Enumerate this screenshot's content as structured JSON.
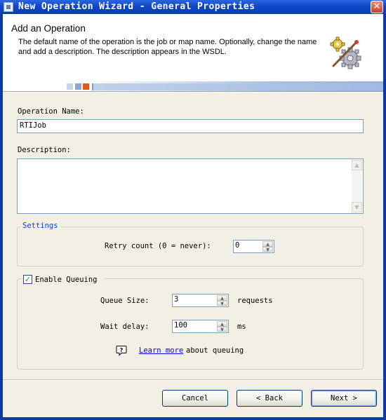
{
  "window": {
    "title": "New Operation Wizard - General Properties",
    "close_glyph": "✕"
  },
  "header": {
    "heading": "Add an Operation",
    "description": "The default name of the operation is the job or map name. Optionally, change the name and add a description. The description appears in the WSDL.",
    "icon": "wizard-gears-icon"
  },
  "form": {
    "operation_name_label": "Operation Name:",
    "operation_name_value": "RTIJob",
    "description_label": "Description:",
    "description_value": ""
  },
  "settings": {
    "legend": "Settings",
    "retry_label": "Retry count (0 = never):",
    "retry_value": "0"
  },
  "queuing": {
    "checkbox_label": "Enable Queuing",
    "checked": true,
    "queue_size_label": "Queue Size:",
    "queue_size_value": "3",
    "queue_size_unit": "requests",
    "wait_delay_label": "Wait delay:",
    "wait_delay_value": "100",
    "wait_delay_unit": "ms",
    "learn_more_link": "Learn more",
    "learn_more_suffix": "about queuing"
  },
  "buttons": {
    "cancel": "Cancel",
    "back": "< Back",
    "next": "Next >"
  },
  "colors": {
    "titlebar": "#0a3cb0",
    "dialog_bg": "#f2f0e4",
    "group_legend": "#0046d5",
    "link": "#0000ee",
    "check": "#21a121"
  }
}
